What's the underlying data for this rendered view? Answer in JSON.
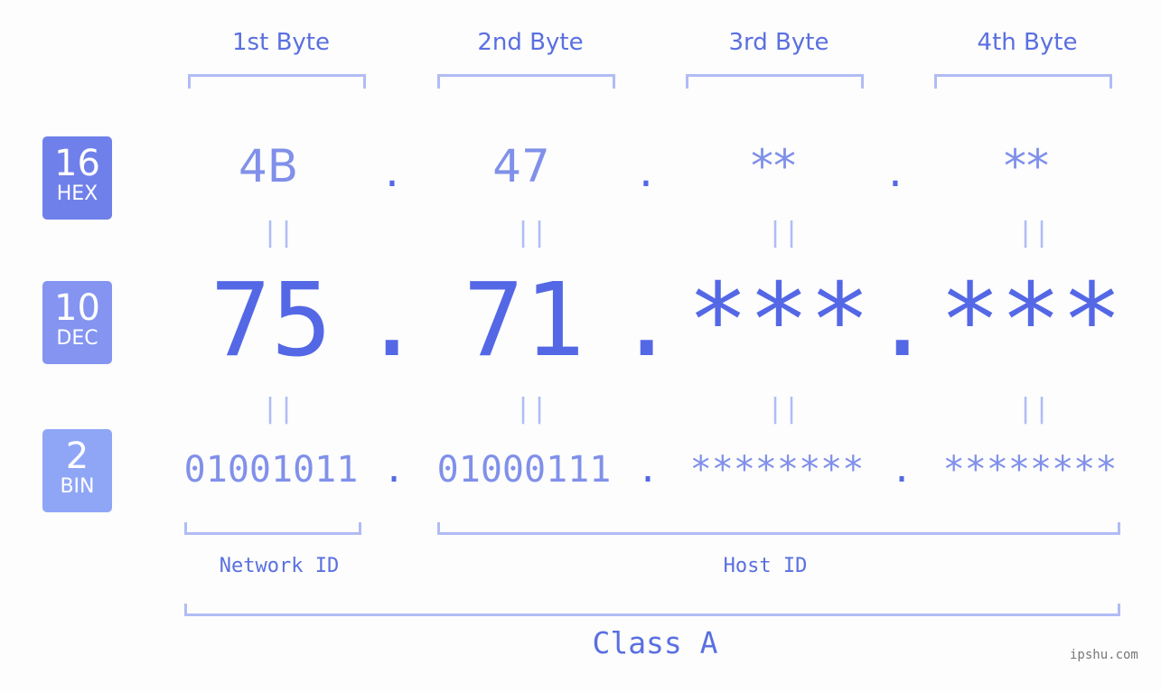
{
  "badges": [
    {
      "number": "16",
      "label": "HEX",
      "color": "#7080ea"
    },
    {
      "number": "10",
      "label": "DEC",
      "color": "#8494f0"
    },
    {
      "number": "2",
      "label": "BIN",
      "color": "#8fa6f7"
    }
  ],
  "byte_headers": [
    "1st Byte",
    "2nd Byte",
    "3rd Byte",
    "4th Byte"
  ],
  "hex": [
    "4B",
    "47",
    "**",
    "**"
  ],
  "dec": [
    "75",
    "71",
    "***",
    "***"
  ],
  "bin": [
    "01001011",
    "01000111",
    "********",
    "********"
  ],
  "separator": ".",
  "equals": "||",
  "network_id_label": "Network ID",
  "host_id_label": "Host ID",
  "class_label": "Class A",
  "watermark": "ipshu.com",
  "colors": {
    "accent": "#5468e6",
    "light": "#b1bcf5",
    "value": "#8090ea"
  }
}
